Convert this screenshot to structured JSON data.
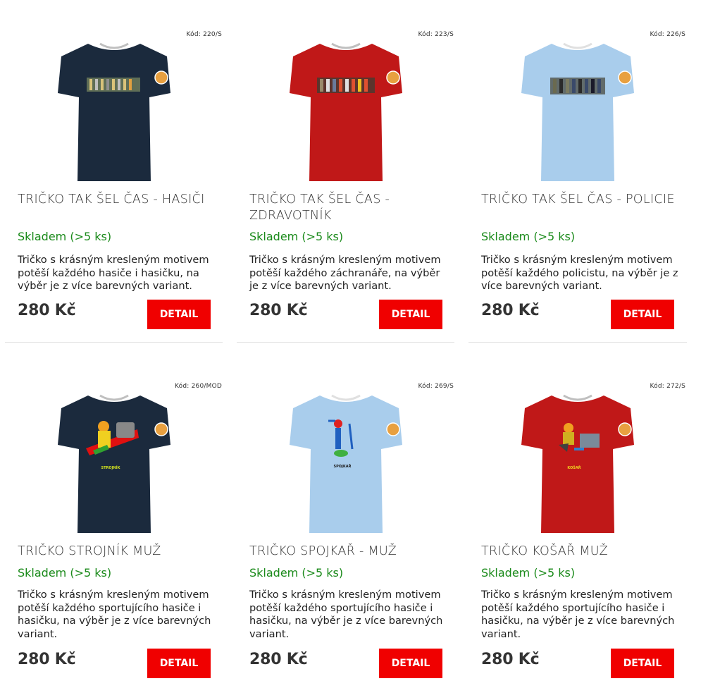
{
  "products": [
    {
      "code": "Kód: 220/S",
      "title": "TRIČKO TAK ŠEL ČAS - HASIČI",
      "stock": "Skladem (>5 ks)",
      "description": "Tričko s krásným kresleným motivem potěší každého hasiče i hasičku, na výběr je z více barevných variant.",
      "price": "280 Kč",
      "button": "DETAIL",
      "shirt_color": "#1b2a3d",
      "print_label": ""
    },
    {
      "code": "Kód: 223/S",
      "title": "TRIČKO TAK ŠEL ČAS - ZDRAVOTNÍK",
      "stock": "Skladem (>5 ks)",
      "description": "Tričko s krásným kresleným motivem potěší každého záchranáře, na výběr je z více barevných variant.",
      "price": "280 Kč",
      "button": "DETAIL",
      "shirt_color": "#c01818",
      "print_label": ""
    },
    {
      "code": "Kód: 226/S",
      "title": "TRIČKO TAK ŠEL ČAS - POLICIE",
      "stock": "Skladem (>5 ks)",
      "description": "Tričko s krásným kresleným motivem potěší každého policistu, na výběr je z více barevných variant.",
      "price": "280 Kč",
      "button": "DETAIL",
      "shirt_color": "#a9cdec",
      "print_label": ""
    },
    {
      "code": "Kód: 260/MOD",
      "title": "TRIČKO STROJNÍK MUŽ",
      "stock": "Skladem (>5 ks)",
      "description": "Tričko s krásným kresleným motivem potěší každého sportujícího hasiče i hasičku, na výběr je z více barevných variant.",
      "price": "280 Kč",
      "button": "DETAIL",
      "shirt_color": "#1b2a3d",
      "print_label": "STROJNÍK"
    },
    {
      "code": "Kód: 269/S",
      "title": "TRIČKO SPOJKAŘ - MUŽ",
      "stock": "Skladem (>5 ks)",
      "description": "Tričko s krásným kresleným motivem potěší každého sportujícího hasiče i hasičku, na výběr je z více barevných variant.",
      "price": "280 Kč",
      "button": "DETAIL",
      "shirt_color": "#a9cdec",
      "print_label": "SPOJKAŘ"
    },
    {
      "code": "Kód: 272/S",
      "title": "TRIČKO KOŠAŘ MUŽ",
      "stock": "Skladem (>5 ks)",
      "description": "Tričko s krásným kresleným motivem potěší každého sportujícího hasiče i hasičku, na výběr je z více barevných variant.",
      "price": "280 Kč",
      "button": "DETAIL",
      "shirt_color": "#c01818",
      "print_label": "KOŠAŘ"
    }
  ],
  "colors": {
    "button_bg": "#f00000",
    "stock_green": "#1a8a1a",
    "divider": "#e2e2e2"
  }
}
